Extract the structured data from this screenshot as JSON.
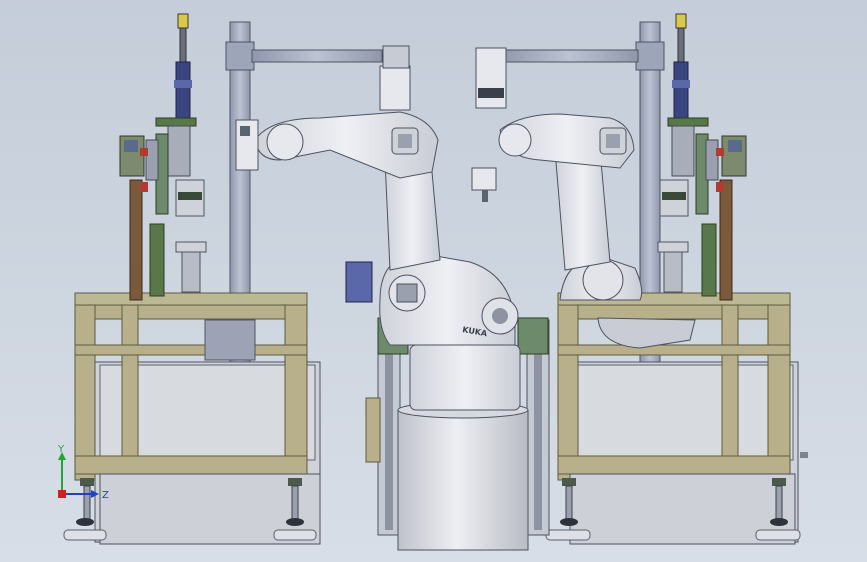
{
  "viewport": {
    "background_top": "#c4cdd9",
    "background_bottom": "#d8dee7"
  },
  "colors": {
    "frame_olive": "#b7b08a",
    "frame_edge": "#5d5a3e",
    "panel_grey": "#cdd0d6",
    "robot_white": "#e6e8ee",
    "pillar_grey": "#a7afc1",
    "fixture_green": "#58774a",
    "fixture_blue": "#3a4580",
    "fixture_yellow": "#d9c94a",
    "fixture_brown": "#7a5a3a",
    "base_green": "#6d8a6b",
    "accent_red": "#b23a2e"
  },
  "robot": {
    "brand_text": "KUKA"
  },
  "triad": {
    "y_label": "Y",
    "z_label": "Z",
    "y_color": "#1ea82d",
    "z_color": "#1f3fd0",
    "x_color": "#d01f1f"
  }
}
